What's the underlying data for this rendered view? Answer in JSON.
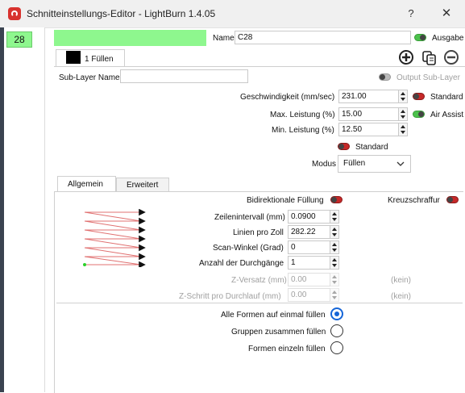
{
  "window": {
    "title": "Schnitteinstellungs-Editor - LightBurn 1.4.05",
    "help_label": "?",
    "close_label": "✕"
  },
  "layers": [
    {
      "label": "28",
      "color": "#8ef78e"
    }
  ],
  "header": {
    "name_label": "Name",
    "name_value": "C28",
    "output_label": "Ausgabe",
    "output_on": true
  },
  "subtabs": [
    {
      "label": "1 Füllen"
    }
  ],
  "sublayer": {
    "name_label": "Sub-Layer Name",
    "name_value": "",
    "output_label": "Output Sub-Layer"
  },
  "params": {
    "speed_label": "Geschwindigkeit (mm/sec)",
    "speed_value": "231.00",
    "speed_toggle_label": "Standard",
    "max_power_label": "Max. Leistung (%)",
    "max_power_value": "15.00",
    "air_assist_label": "Air Assist",
    "air_assist_on": true,
    "min_power_label": "Min. Leistung (%)",
    "min_power_value": "12.50",
    "standard_label": "Standard",
    "mode_label": "Modus",
    "mode_value": "Füllen"
  },
  "tabs": [
    {
      "label": "Allgemein",
      "active": true
    },
    {
      "label": "Erweitert",
      "active": false
    }
  ],
  "fill": {
    "bidirectional_label": "Bidirektionale Füllung",
    "crosshatch_label": "Kreuzschraffur",
    "interval_label": "Zeilenintervall (mm)",
    "interval_value": "0.0900",
    "lpi_label": "Linien pro Zoll",
    "lpi_value": "282.22",
    "scan_angle_label": "Scan-Winkel (Grad)",
    "scan_angle_value": "0",
    "passes_label": "Anzahl der Durchgänge",
    "passes_value": "1",
    "z_offset_label": "Z-Versatz (mm)",
    "z_offset_value": "0.00",
    "z_offset_unit": "(kein)",
    "z_step_label": "Z-Schritt pro Durchlauf (mm)",
    "z_step_value": "0.00",
    "z_step_unit": "(kein)"
  },
  "fill_options": [
    {
      "label": "Alle Formen auf einmal füllen",
      "selected": true
    },
    {
      "label": "Gruppen zusammen füllen",
      "selected": false
    },
    {
      "label": "Formen einzeln füllen",
      "selected": false
    }
  ],
  "icons": {
    "add": "plus-circle-icon",
    "copy": "copy-icon",
    "remove": "minus-circle-icon",
    "dropdown": "chevron-down-icon",
    "app": "lightburn-logo-icon"
  },
  "colors": {
    "layer_green": "#8ef78e",
    "toggle_on": "#4cc24c",
    "toggle_off": "#c62828",
    "radio_accent": "#1565d8"
  }
}
